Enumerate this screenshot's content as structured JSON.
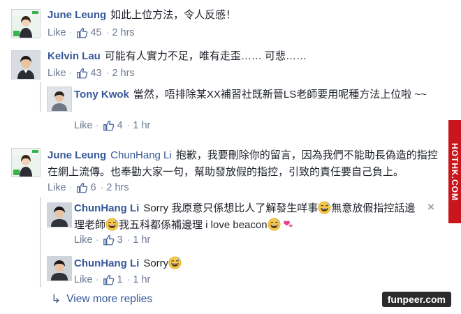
{
  "comments": [
    {
      "author": "June Leung",
      "avatar": "june-leung-avatar",
      "text": "如此上位方法，令人反感！",
      "like_label": "Like",
      "likes": "45",
      "time": "2 hrs"
    },
    {
      "author": "Kelvin Lau",
      "avatar": "kelvin-lau-avatar",
      "text": "可能有人實力不足，唯有走歪…… 可悲……",
      "like_label": "Like",
      "likes": "43",
      "time": "2 hrs",
      "replies": [
        {
          "author": "Tony Kwok",
          "avatar": "tony-kwok-avatar",
          "text": "當然，唔排除某XX補習社既新晉LS老師要用呢種方法上位啦 ~~",
          "like_label": "Like",
          "likes": "4",
          "time": "1 hr"
        }
      ]
    },
    {
      "author": "June Leung",
      "avatar": "june-leung-avatar",
      "mention": "ChunHang Li",
      "text": "抱歉，我要刪除你的留言，因為我們不能助長偽造的指控在網上流傳。也奉勸大家一句，幫助發放假的指控，引致的責任要自己負上。",
      "like_label": "Like",
      "likes": "6",
      "time": "2 hrs",
      "replies": [
        {
          "author": "ChunHang Li",
          "avatar": "chunhang-li-avatar",
          "text_part1": "Sorry 我原意只係想比人了解發生咩事",
          "text_part2": "無意放假指控話邊",
          "text_part3": "理老師",
          "text_part4": "我五科都係補邊理 i love beacon",
          "emoji": "grinning-sweat-emoji",
          "like_label": "Like",
          "likes": "3",
          "time": "1 hr",
          "close": "×"
        },
        {
          "author": "ChunHang Li",
          "avatar": "chunhang-li-avatar",
          "text": "Sorry",
          "emoji": "grinning-sweat-emoji",
          "like_label": "Like",
          "likes": "1",
          "time": "1 hr"
        }
      ],
      "view_more": "View more replies"
    }
  ],
  "watermarks": {
    "side": "HOTHK.COM",
    "bottom": "funpeer.com"
  },
  "colors": {
    "link": "#365899",
    "meta": "#6c7a93",
    "thumb": "#4b67a1",
    "watermark_red": "#c9161d"
  }
}
